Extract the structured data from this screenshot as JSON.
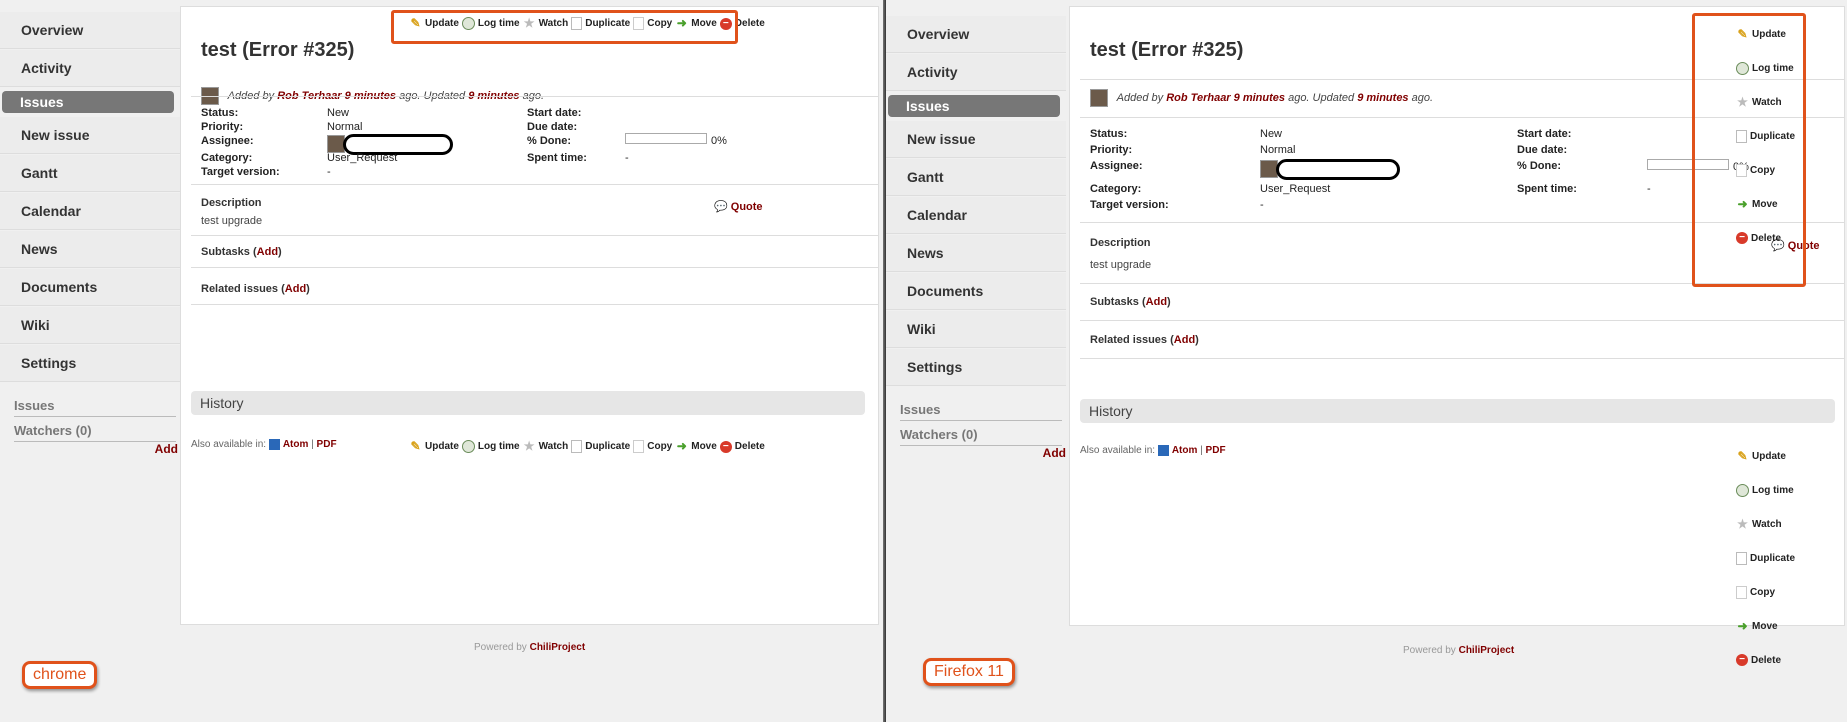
{
  "sidebar": {
    "items": [
      {
        "label": "Overview"
      },
      {
        "label": "Activity"
      },
      {
        "label": "Issues"
      },
      {
        "label": "New issue"
      },
      {
        "label": "Gantt"
      },
      {
        "label": "Calendar"
      },
      {
        "label": "News"
      },
      {
        "label": "Documents"
      },
      {
        "label": "Wiki"
      },
      {
        "label": "Settings"
      }
    ],
    "issues_label": "Issues",
    "watchers_label": "Watchers (0)",
    "add_label": "Add"
  },
  "issue": {
    "title": "test (Error #325)",
    "added_prefix": "Added by",
    "author": "Rob Terhaar",
    "added_ago": "9 minutes",
    "ago_updated": "ago. Updated",
    "updated_ago": "9 minutes",
    "ago_end": "ago.",
    "attributes": {
      "status_label": "Status:",
      "status_value": "New",
      "priority_label": "Priority:",
      "priority_value": "Normal",
      "assignee_label": "Assignee:",
      "category_label": "Category:",
      "category_value": "User_Request",
      "target_label": "Target version:",
      "target_value": "-",
      "start_label": "Start date:",
      "due_label": "Due date:",
      "done_label": "% Done:",
      "done_value": "0%",
      "done_fraction": 0,
      "spent_label": "Spent time:",
      "spent_value": "-"
    },
    "description_label": "Description",
    "description_text": "test upgrade",
    "quote_label": "Quote",
    "subtasks_label": "Subtasks",
    "related_label": "Related issues",
    "add_link": "Add",
    "history_label": "History",
    "also_available": "Also available in:",
    "atom_label": "Atom",
    "pdf_label": "PDF"
  },
  "toolbar": {
    "update": "Update",
    "log_time": "Log time",
    "watch": "Watch",
    "duplicate": "Duplicate",
    "copy": "Copy",
    "move": "Move",
    "delete": "Delete"
  },
  "footer": {
    "powered_by": "Powered by",
    "project": "ChiliProject"
  },
  "labels": {
    "chrome": "chrome",
    "firefox": "Firefox 11"
  },
  "colors": {
    "highlight": "#e0521b",
    "link": "#800000"
  }
}
